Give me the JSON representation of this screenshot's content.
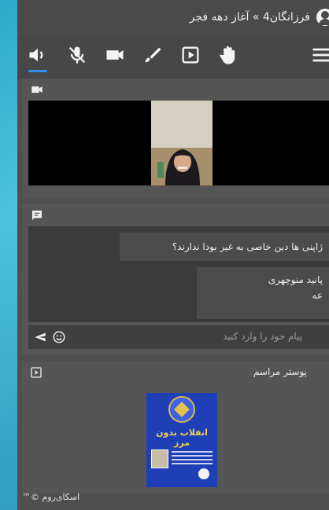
{
  "header": {
    "breadcrumb": "فرزانگان4 » آغاز دهه فجر",
    "avatar_icon": "user-circle-icon"
  },
  "toolbar": {
    "items": [
      {
        "name": "speaker-icon",
        "active": true
      },
      {
        "name": "mic-muted-icon",
        "active": false
      },
      {
        "name": "camera-icon",
        "active": false
      },
      {
        "name": "brush-icon",
        "active": false
      },
      {
        "name": "play-box-icon",
        "active": false
      },
      {
        "name": "hand-icon",
        "active": false
      },
      {
        "name": "menu-icon",
        "active": false
      }
    ],
    "accent_color": "#2f8ff0"
  },
  "video_panel": {
    "icon": "video-camera-icon"
  },
  "chat": {
    "icon": "chat-icon",
    "messages": [
      {
        "text": "ژاپنی ها دین خاصی به غیر بودا ندارند؟"
      },
      {
        "author": "پانید منوچهری",
        "text": "عه"
      }
    ],
    "input_placeholder": "پیام خود را وارد کنید",
    "send_icon": "send-icon",
    "emoji_icon": "emoji-icon"
  },
  "poster_panel": {
    "icon": "presentation-icon",
    "title": "پوستر مراسم",
    "poster_headline": "انقلاب بدون مرز"
  },
  "footer": {
    "brand": "اسکای‌روم ©™"
  }
}
